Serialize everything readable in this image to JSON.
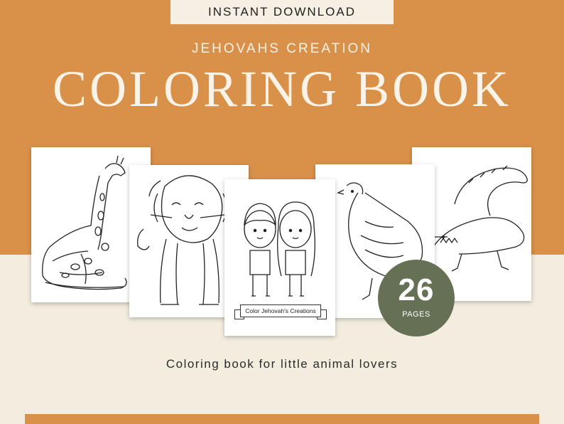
{
  "header": {
    "badge": "INSTANT DOWNLOAD",
    "subtitle": "JEHOVAHS CREATION",
    "title": "COLORING BOOK"
  },
  "pages": {
    "kids_banner": "Color Jehovah's Creations"
  },
  "count_badge": {
    "number": "26",
    "label": "PAGES"
  },
  "tagline": "Coloring book for little animal lovers",
  "colors": {
    "accent_orange": "#d9914a",
    "cream": "#f3ecdf",
    "badge_green": "#667055"
  }
}
